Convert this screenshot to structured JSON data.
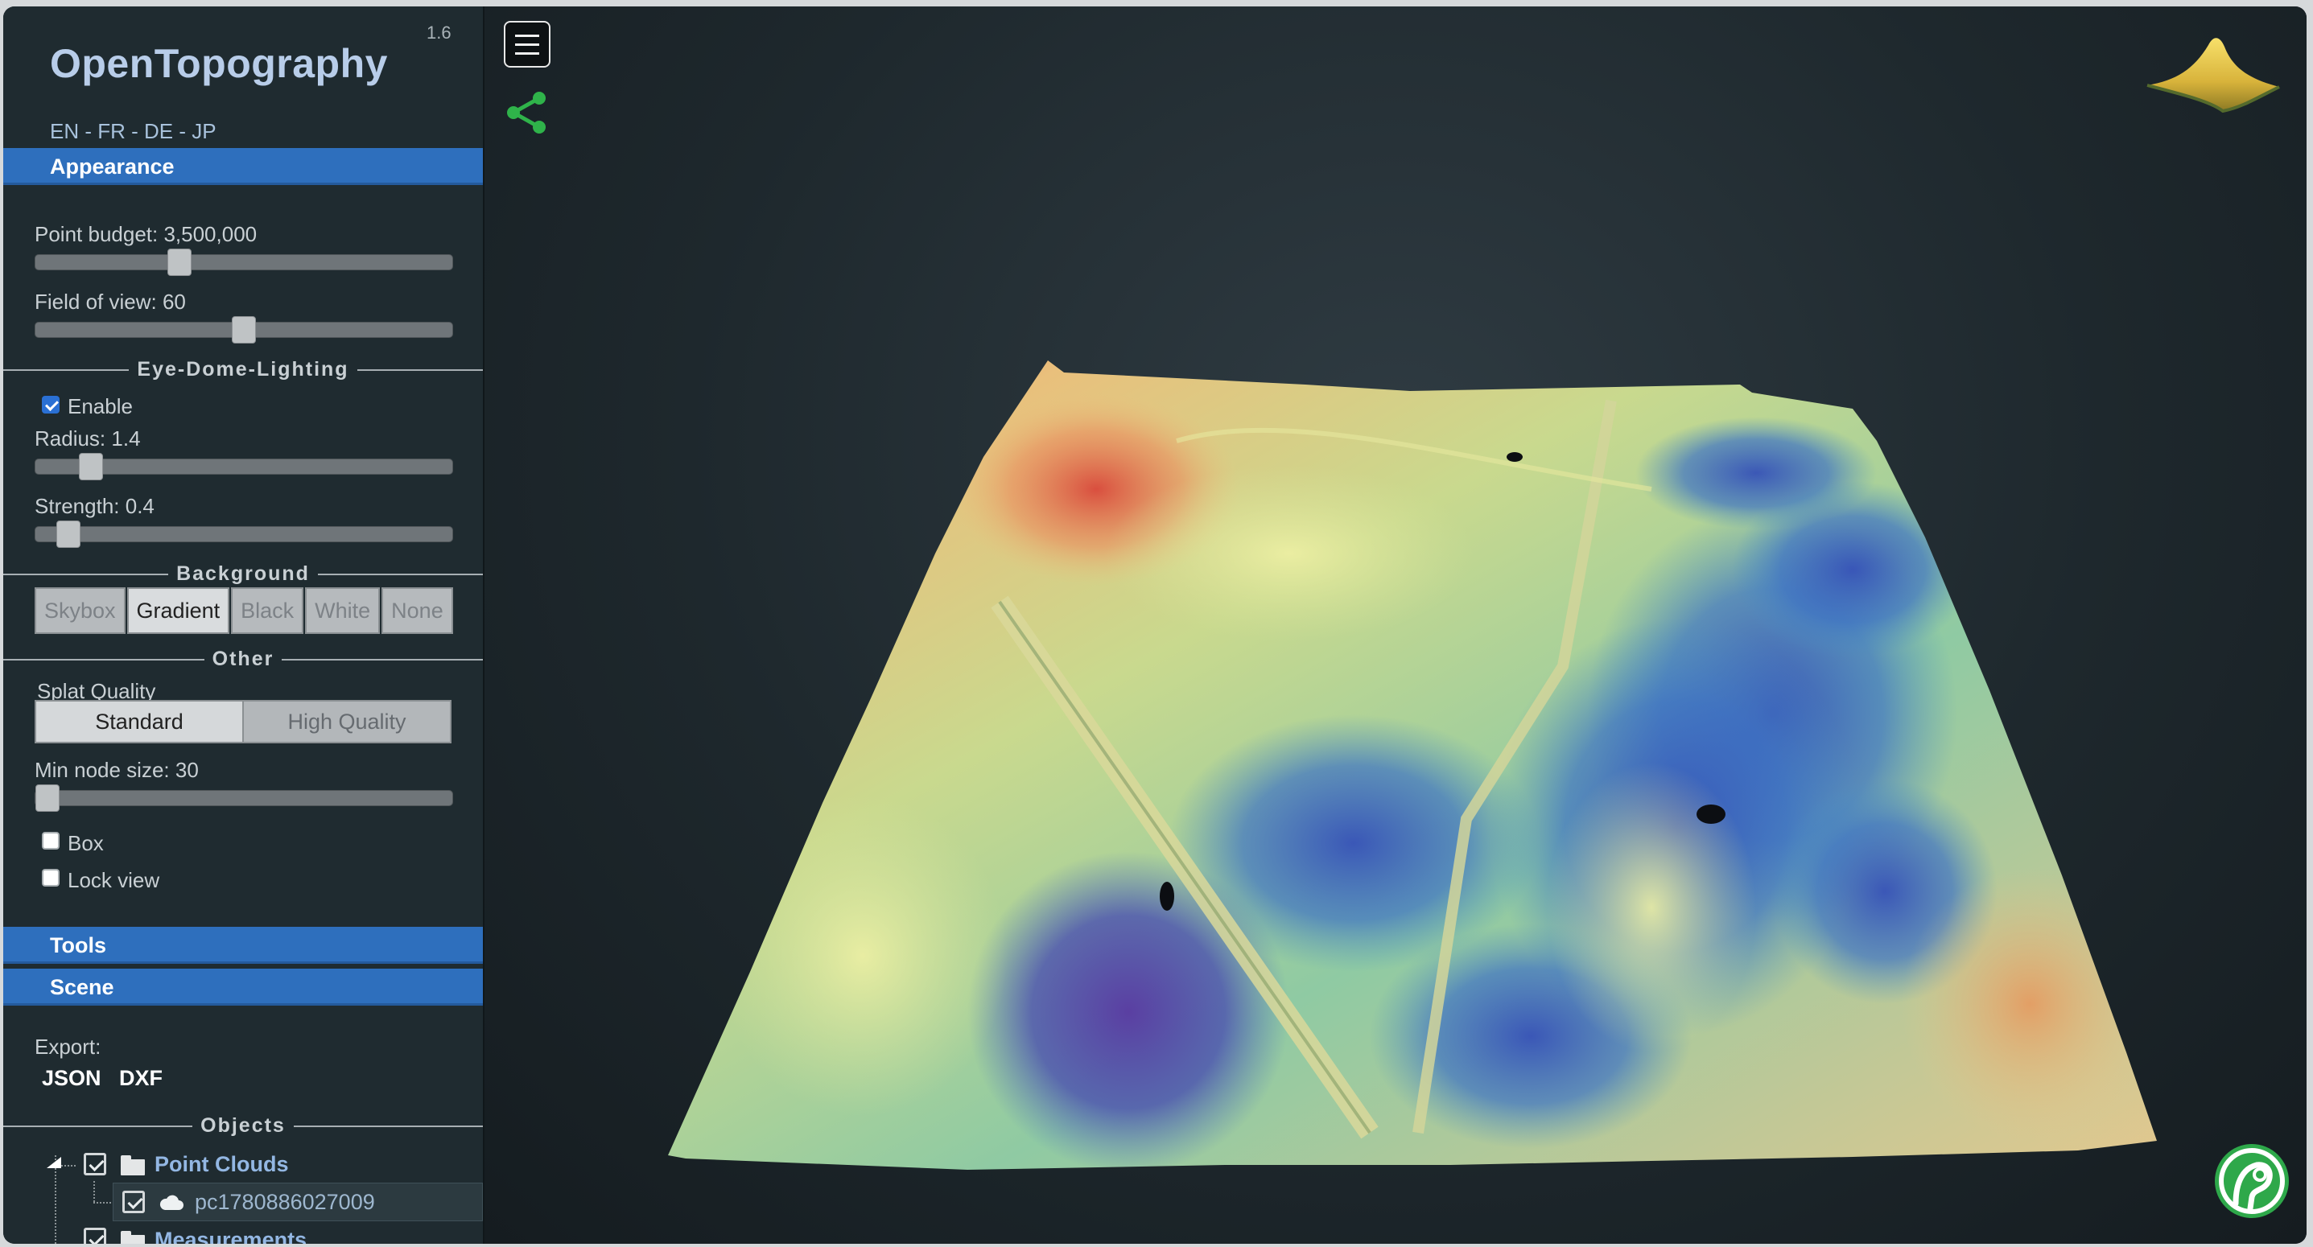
{
  "app": {
    "title": "OpenTopography",
    "version": "1.6"
  },
  "languages": [
    "EN",
    "FR",
    "DE",
    "JP"
  ],
  "language_separator": " - ",
  "sections": {
    "appearance": "Appearance",
    "tools": "Tools",
    "scene": "Scene"
  },
  "appearance": {
    "point_budget": {
      "label": "Point budget: 3,500,000",
      "value": 3500000,
      "fraction": 0.35
    },
    "field_of_view": {
      "label": "Field of view: 60",
      "value": 60,
      "fraction": 0.5
    },
    "edl": {
      "title": "Eye-Dome-Lighting",
      "enable_label": "Enable",
      "enabled": true,
      "radius": {
        "label": "Radius: 1.4",
        "value": 1.4,
        "fraction": 0.13
      },
      "strength": {
        "label": "Strength: 0.4",
        "value": 0.4,
        "fraction": 0.08
      }
    },
    "background": {
      "title": "Background",
      "options": [
        "Skybox",
        "Gradient",
        "Black",
        "White",
        "None"
      ],
      "selected": "Gradient"
    },
    "other": {
      "title": "Other",
      "splat_quality_label": "Splat Quality",
      "splat_options": [
        "Standard",
        "High Quality"
      ],
      "splat_selected": "Standard",
      "min_node_size": {
        "label": "Min node size: 30",
        "value": 30,
        "fraction": 0.0
      },
      "box_label": "Box",
      "box_checked": false,
      "lock_view_label": "Lock view",
      "lock_view_checked": false
    }
  },
  "scene": {
    "export_label": "Export:",
    "export_formats": [
      "JSON",
      "DXF"
    ],
    "objects_title": "Objects",
    "tree": {
      "point_clouds": "Point Clouds",
      "point_cloud_item": "pc1780886027009",
      "measurements": "Measurements"
    }
  },
  "icons": {
    "menu": "hamburger-menu-icon",
    "share": "share-icon",
    "navigation_cube": "terrain-logo-icon",
    "brand": "opentopography-logo-icon"
  },
  "colors": {
    "section_header": "#2e6fbd",
    "sidebar_bg": "#1f2b30",
    "share_green": "#2fb34a",
    "brand_green": "#2ea84a"
  }
}
